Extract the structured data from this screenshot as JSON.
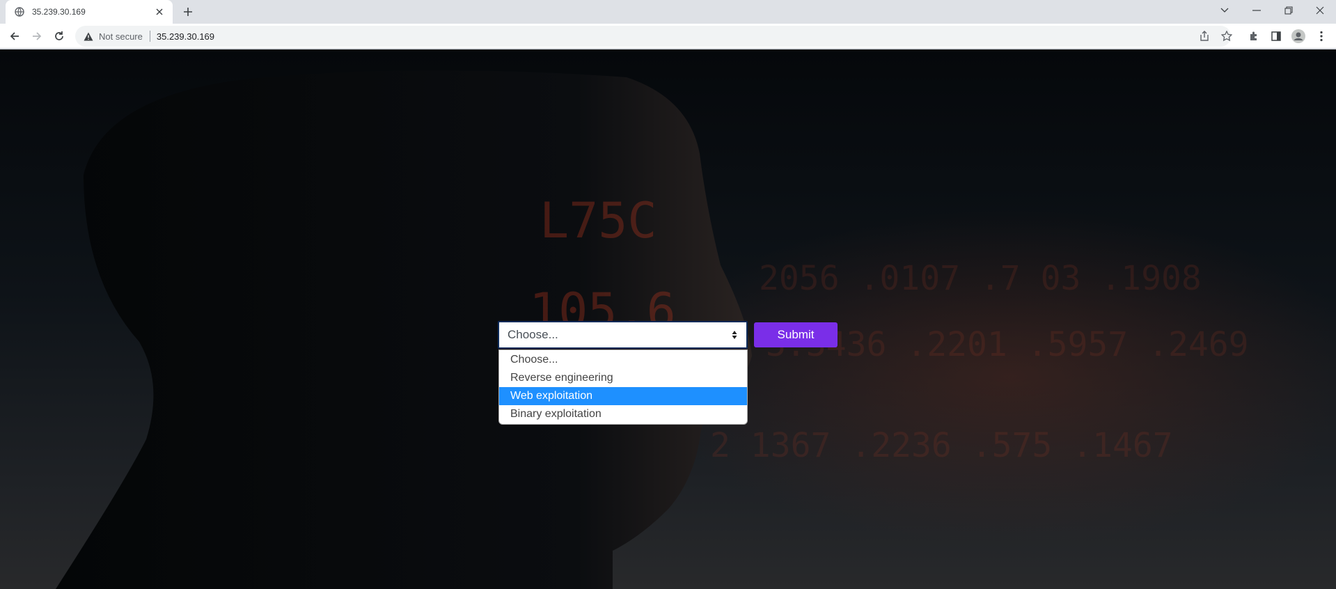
{
  "browser": {
    "tab": {
      "title": "35.239.30.169",
      "favicon": "globe-icon",
      "close_icon": "close-icon"
    },
    "new_tab_icon": "plus-icon",
    "window_controls": [
      "chevron-down-icon",
      "minimize-icon",
      "restore-icon",
      "close-icon"
    ],
    "nav_icons": [
      "back-arrow-icon",
      "forward-arrow-icon",
      "reload-icon"
    ],
    "address_bar": {
      "security_text": "Not secure",
      "url": "35.239.30.169"
    },
    "toolbar_icons": [
      "share-icon",
      "star-icon",
      "extensions-icon",
      "side-panel-icon",
      "profile-icon",
      "menu-icon"
    ]
  },
  "form": {
    "select": {
      "value": "Choose...",
      "options": [
        {
          "label": "Choose...",
          "selected": false
        },
        {
          "label": "Reverse engineering",
          "selected": false
        },
        {
          "label": "Web exploitation",
          "selected": true
        },
        {
          "label": "Binary exploitation",
          "selected": false
        }
      ]
    },
    "submit_label": "Submit"
  },
  "colors": {
    "submit_bg": "#7a2ee8",
    "highlight": "#1e90ff",
    "background_glow": "#b3361f"
  }
}
